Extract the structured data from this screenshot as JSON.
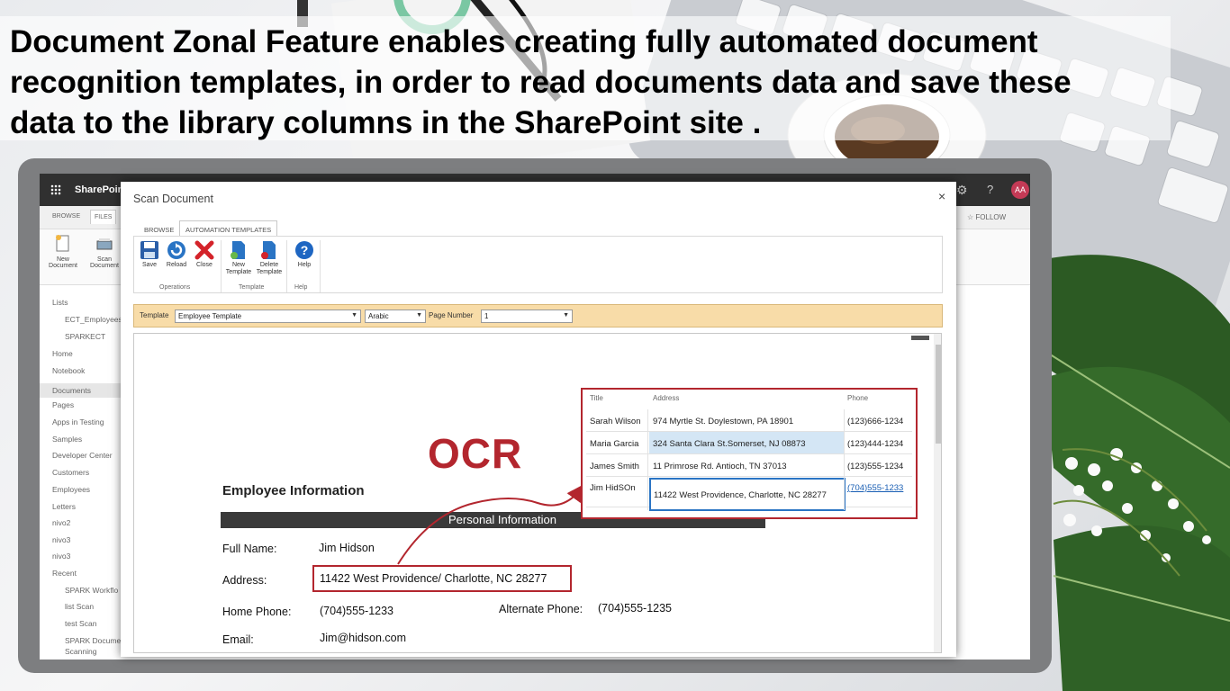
{
  "headline": [
    "Document Zonal Feature enables creating fully automated document",
    "recognition templates, in order to read documents data and save these",
    "data to the library columns in the SharePoint site ."
  ],
  "sharepoint": {
    "brand": "SharePoin",
    "avatar": "AA",
    "tabs": [
      "BROWSE",
      "FILES"
    ],
    "follow_label": "FOLLOW",
    "ribbon": [
      {
        "label": "New Document",
        "icon": "new-document-icon"
      },
      {
        "label": "Scan Document",
        "icon": "scanner-icon"
      }
    ],
    "nav": [
      {
        "label": "Lists",
        "indent": false,
        "selected": false
      },
      {
        "label": "ECT_Employees",
        "indent": true,
        "selected": false
      },
      {
        "label": "SPARKECT",
        "indent": true,
        "selected": false
      },
      {
        "label": "Home",
        "indent": false,
        "selected": false
      },
      {
        "label": "Notebook",
        "indent": false,
        "selected": false
      },
      {
        "label": "Documents",
        "indent": false,
        "selected": true
      },
      {
        "label": "Pages",
        "indent": false,
        "selected": false
      },
      {
        "label": "Apps in Testing",
        "indent": false,
        "selected": false
      },
      {
        "label": "Samples",
        "indent": false,
        "selected": false
      },
      {
        "label": "Developer Center",
        "indent": false,
        "selected": false
      },
      {
        "label": "Customers",
        "indent": false,
        "selected": false
      },
      {
        "label": "Employees",
        "indent": false,
        "selected": false
      },
      {
        "label": "Letters",
        "indent": false,
        "selected": false
      },
      {
        "label": "nivo2",
        "indent": false,
        "selected": false
      },
      {
        "label": "nivo3",
        "indent": false,
        "selected": false
      },
      {
        "label": "nivo3",
        "indent": false,
        "selected": false
      },
      {
        "label": "Recent",
        "indent": false,
        "selected": false
      },
      {
        "label": "SPARK Workflo",
        "indent": true,
        "selected": false
      },
      {
        "label": "list Scan",
        "indent": true,
        "selected": false
      },
      {
        "label": "test Scan",
        "indent": true,
        "selected": false
      },
      {
        "label": "SPARK Docume",
        "indent": true,
        "selected": false
      },
      {
        "label": "Scanning",
        "indent": true,
        "selected": false
      }
    ]
  },
  "dialog": {
    "title": "Scan Document",
    "close": "×",
    "tabs": [
      "BROWSE",
      "AUTOMATION TEMPLATES"
    ],
    "ribbon": {
      "groups": [
        {
          "label": "Operations",
          "buttons": [
            {
              "label": "Save",
              "icon": "save-icon"
            },
            {
              "label": "Reload",
              "icon": "reload-icon"
            },
            {
              "label": "Close",
              "icon": "close-x-icon"
            }
          ]
        },
        {
          "label": "Template",
          "buttons": [
            {
              "label1": "New",
              "label2": "Template",
              "icon": "new-template-icon"
            },
            {
              "label1": "Delete",
              "label2": "Template",
              "icon": "delete-template-icon"
            }
          ]
        },
        {
          "label": "Help",
          "buttons": [
            {
              "label": "Help",
              "icon": "help-icon"
            }
          ]
        }
      ]
    },
    "template_bar": {
      "template_label": "Template",
      "template_value": "Employee Template",
      "language_value": "Arabic",
      "page_label": "Page Number",
      "page_value": "1"
    },
    "document": {
      "heading": "Employee Information",
      "section": "Personal Information",
      "ocr_label": "OCR",
      "fields": [
        {
          "label": "Full Name:",
          "value": "Jim Hidson"
        },
        {
          "label": "Address:",
          "value": "11422 West Providence/  Charlotte, NC 28277"
        },
        {
          "label": "Home Phone:",
          "value": "(704)555-1233"
        },
        {
          "label": "Alternate Phone:",
          "value": "(704)555-1235"
        },
        {
          "label": "Email:",
          "value": "Jim@hidson.com"
        }
      ]
    },
    "extracted_table": {
      "headers": [
        "Title",
        "Address",
        "Phone"
      ],
      "rows": [
        {
          "title": "Sarah Wilson",
          "address": "974 Myrtle St.  Doylestown, PA 18901",
          "phone": "(123)666-1234"
        },
        {
          "title": "Maria Garcia",
          "address": "324 Santa Clara St.Somerset, NJ 08873",
          "phone": "(123)444-1234"
        },
        {
          "title": "James Smith",
          "address": "11 Primrose Rd.  Antioch, TN 37013",
          "phone": "(123)555-1234"
        },
        {
          "title": "Jim HidSOn",
          "address": "11422 West Providence, Charlotte, NC 28277",
          "phone": "(704)555-1233"
        }
      ],
      "highlight_color": "#d4e6f5",
      "accent_color": "#b3262e"
    }
  }
}
